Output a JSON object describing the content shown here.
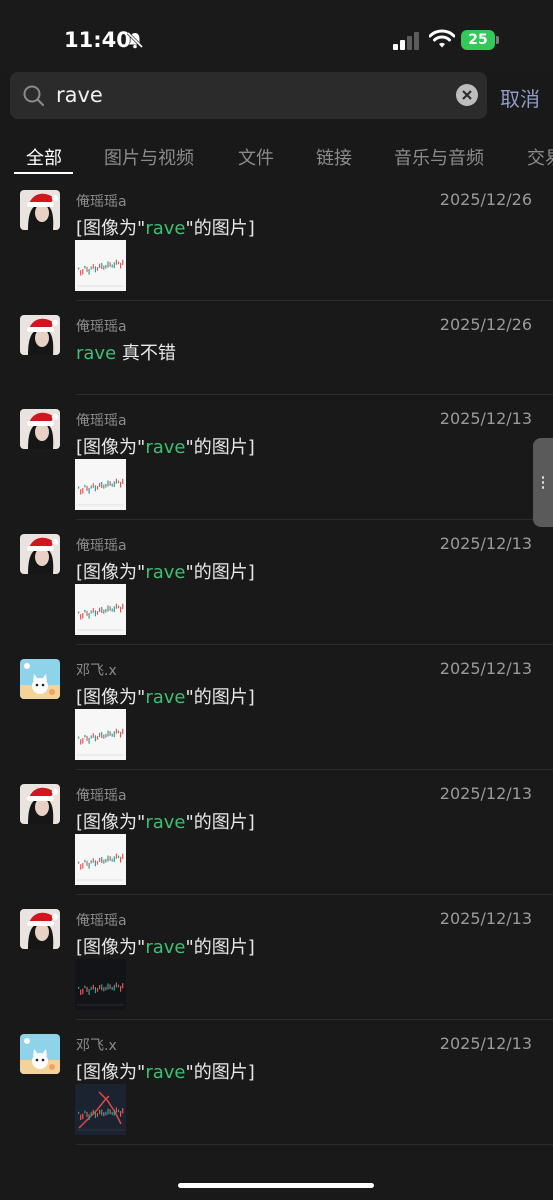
{
  "status_bar": {
    "time": "11:40",
    "battery": "25"
  },
  "search": {
    "query": "rave",
    "cancel_label": "取消"
  },
  "tabs": [
    {
      "label": "全部",
      "active": true
    },
    {
      "label": "图片与视频"
    },
    {
      "label": "文件"
    },
    {
      "label": "链接"
    },
    {
      "label": "音乐与音频"
    },
    {
      "label": "交易"
    }
  ],
  "results": [
    {
      "sender": "俺瑶瑶a",
      "avatar": "santa-avatar",
      "date": "2025/12/26",
      "pre": "[图像为\"",
      "hl": "rave",
      "post": "\"的图片]",
      "thumb": "light"
    },
    {
      "sender": "俺瑶瑶a",
      "avatar": "santa-avatar",
      "date": "2025/12/26",
      "pre": "",
      "hl": "rave",
      "post": " 真不错",
      "thumb": ""
    },
    {
      "sender": "俺瑶瑶a",
      "avatar": "santa-avatar",
      "date": "2025/12/13",
      "pre": "[图像为\"",
      "hl": "rave",
      "post": "\"的图片]",
      "thumb": "light"
    },
    {
      "sender": "俺瑶瑶a",
      "avatar": "santa-avatar",
      "date": "2025/12/13",
      "pre": "[图像为\"",
      "hl": "rave",
      "post": "\"的图片]",
      "thumb": "light"
    },
    {
      "sender": "邓飞.x",
      "avatar": "cat-beach-avatar",
      "date": "2025/12/13",
      "pre": "[图像为\"",
      "hl": "rave",
      "post": "\"的图片]",
      "thumb": "light"
    },
    {
      "sender": "俺瑶瑶a",
      "avatar": "santa-avatar",
      "date": "2025/12/13",
      "pre": "[图像为\"",
      "hl": "rave",
      "post": "\"的图片]",
      "thumb": "light"
    },
    {
      "sender": "俺瑶瑶a",
      "avatar": "santa-avatar",
      "date": "2025/12/13",
      "pre": "[图像为\"",
      "hl": "rave",
      "post": "\"的图片]",
      "thumb": "dark"
    },
    {
      "sender": "邓飞.x",
      "avatar": "cat-beach-avatar",
      "date": "2025/12/13",
      "pre": "[图像为\"",
      "hl": "rave",
      "post": "\"的图片]",
      "thumb": "dark-red"
    }
  ]
}
